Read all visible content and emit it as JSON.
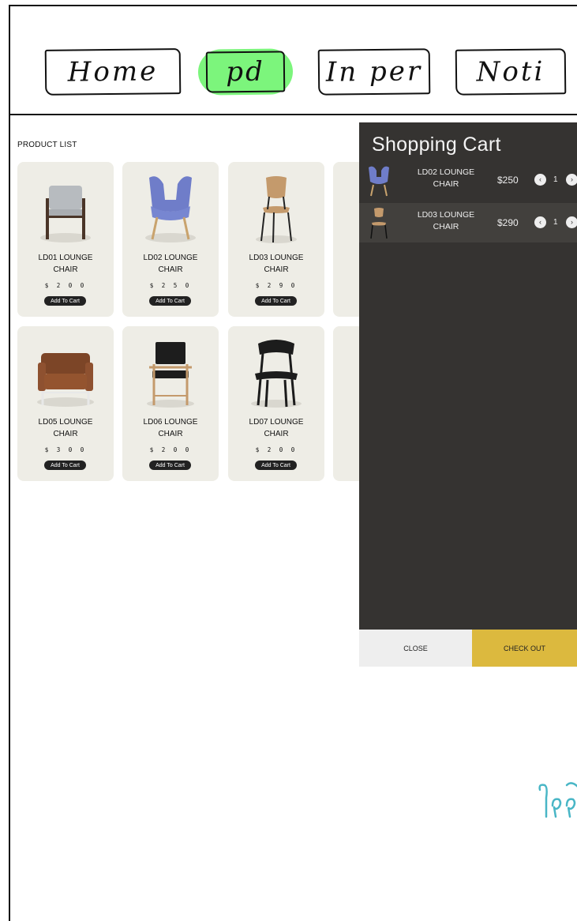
{
  "nav": {
    "items": [
      {
        "label": "Home"
      },
      {
        "label": "pd",
        "active": true,
        "highlight_color": "#7cf57c"
      },
      {
        "label": "In per"
      },
      {
        "label": "Noti"
      }
    ]
  },
  "product_list": {
    "title": "PRODUCT LIST",
    "add_label": "Add To Cart",
    "items": [
      {
        "name": "LD01 LOUNGE\nCHAIR",
        "price": "$ 2 0 0"
      },
      {
        "name": "LD02 LOUNGE\nCHAIR",
        "price": "$ 2 5 0"
      },
      {
        "name": "LD03 LOUNGE\nCHAIR",
        "price": "$ 2 9 0"
      },
      {
        "name": "LD05 LOUNGE\nCHAIR",
        "price": "$ 3 0 0"
      },
      {
        "name": "LD06 LOUNGE\nCHAIR",
        "price": "$ 2 0 0"
      },
      {
        "name": "LD07 LOUNGE\nCHAIR",
        "price": "$ 2 0 0"
      }
    ],
    "card_color": "#eeede6"
  },
  "cart": {
    "title": "Shopping Cart",
    "background": "#353331",
    "items": [
      {
        "name": "LD02 LOUNGE\nCHAIR",
        "price": "$250",
        "qty": "1"
      },
      {
        "name": "LD03 LOUNGE\nCHAIR",
        "price": "$290",
        "qty": "1"
      }
    ],
    "close_label": "CLOSE",
    "checkout_label": "CHECK OUT",
    "checkout_color": "#dcb93e"
  },
  "icons": {
    "minus": "chevron-left-icon",
    "plus": "chevron-right-icon"
  }
}
